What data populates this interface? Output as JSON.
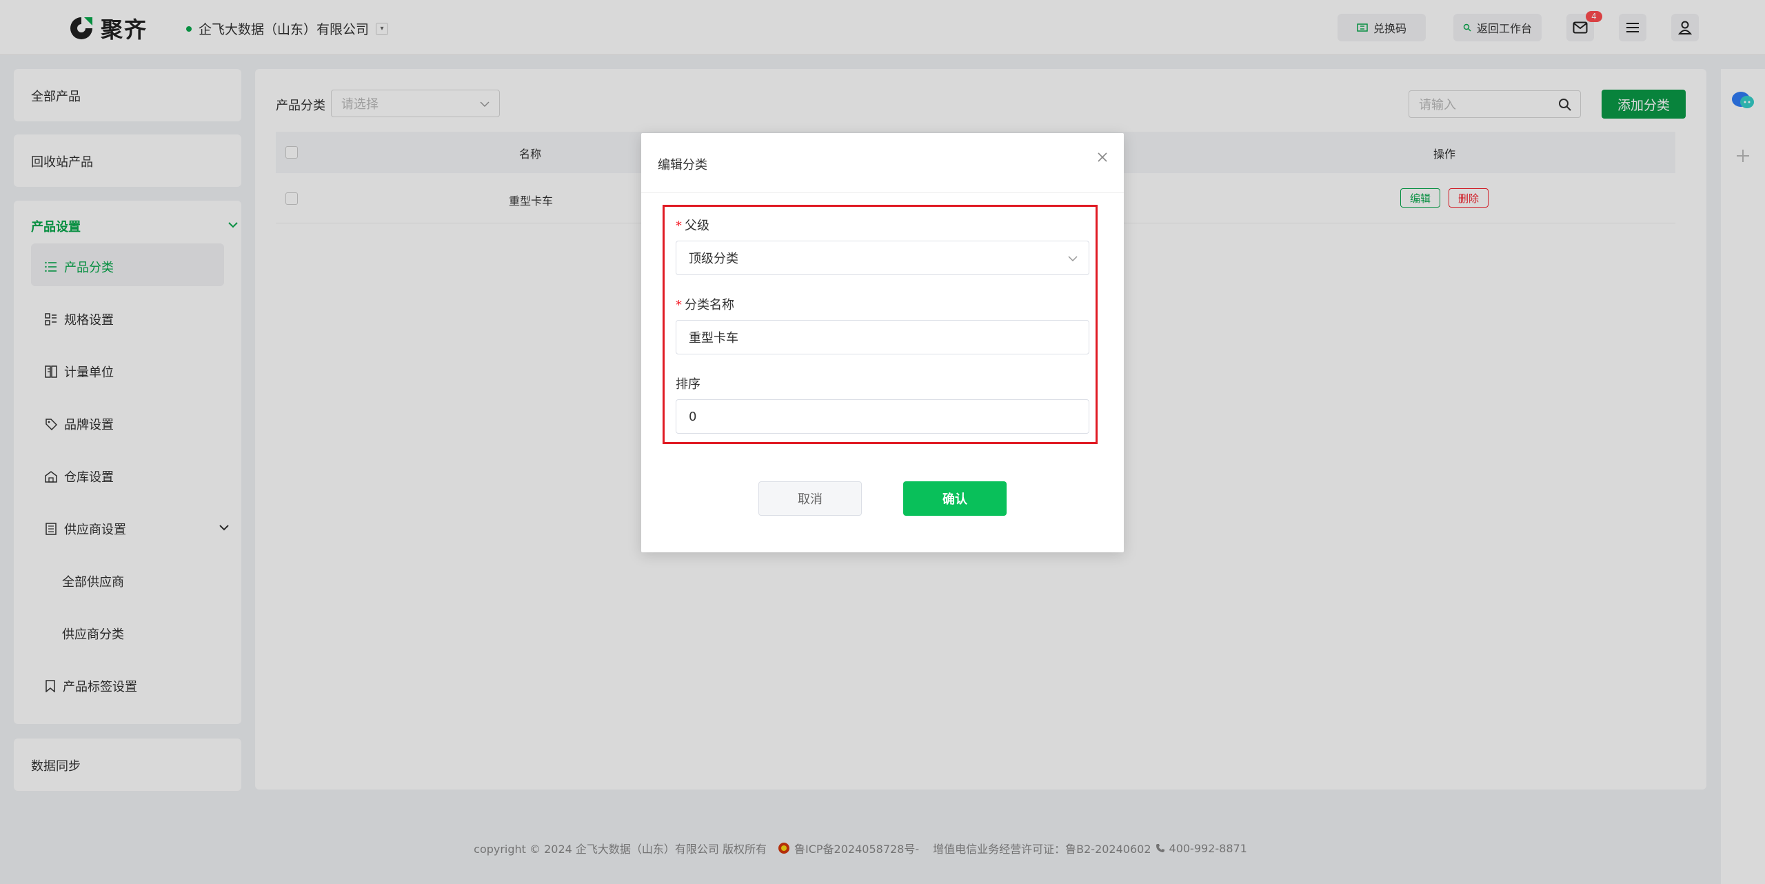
{
  "header": {
    "logo_text": "聚齐",
    "company": "企飞大数据（山东）有限公司",
    "redeem_label": "兑换码",
    "workspace_label": "返回工作台",
    "mail_badge": "4"
  },
  "sidebar": {
    "all_products": "全部产品",
    "recycle_products": "回收站产品",
    "settings_group": "产品设置",
    "items": [
      {
        "label": "产品分类"
      },
      {
        "label": "规格设置"
      },
      {
        "label": "计量单位"
      },
      {
        "label": "品牌设置"
      },
      {
        "label": "仓库设置"
      },
      {
        "label": "供应商设置"
      },
      {
        "label": "全部供应商"
      },
      {
        "label": "供应商分类"
      },
      {
        "label": "产品标签设置"
      }
    ],
    "data_sync": "数据同步"
  },
  "main": {
    "filter_label": "产品分类",
    "filter_placeholder": "请选择",
    "search_placeholder": "请输入",
    "add_button": "添加分类",
    "columns": {
      "name": "名称",
      "actions": "操作"
    },
    "rows": [
      {
        "name": "重型卡车",
        "edit": "编辑",
        "delete": "删除"
      }
    ]
  },
  "dialog": {
    "title": "编辑分类",
    "parent_label": "父级",
    "parent_value": "顶级分类",
    "name_label": "分类名称",
    "name_value": "重型卡车",
    "sort_label": "排序",
    "sort_value": "0",
    "cancel": "取消",
    "confirm": "确认"
  },
  "footer": {
    "copyright": "copyright © 2024 企飞大数据（山东）有限公司 版权所有",
    "icp": "鲁ICP备2024058728号-",
    "license": "增值电信业务经营许可证：鲁B2-20240602",
    "phone": "400-992-8871"
  },
  "colors": {
    "brand": "#0a9a47",
    "danger": "#f5222d",
    "highlight": "#e01b24"
  }
}
